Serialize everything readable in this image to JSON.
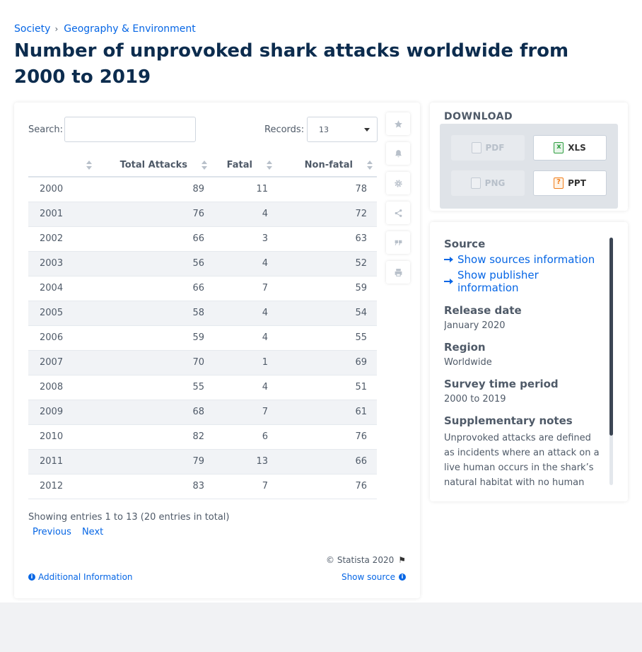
{
  "breadcrumb": {
    "items": [
      "Society",
      "Geography & Environment"
    ],
    "separator": "›"
  },
  "title": "Number of unprovoked shark attacks worldwide from 2000 to 2019",
  "table_controls": {
    "search_label": "Search:",
    "search_value": "",
    "records_label": "Records:",
    "records_value": "13"
  },
  "table": {
    "columns": [
      "",
      "Total Attacks",
      "Fatal",
      "Non-fatal"
    ],
    "rows": [
      [
        "2000",
        "89",
        "11",
        "78"
      ],
      [
        "2001",
        "76",
        "4",
        "72"
      ],
      [
        "2002",
        "66",
        "3",
        "63"
      ],
      [
        "2003",
        "56",
        "4",
        "52"
      ],
      [
        "2004",
        "66",
        "7",
        "59"
      ],
      [
        "2005",
        "58",
        "4",
        "54"
      ],
      [
        "2006",
        "59",
        "4",
        "55"
      ],
      [
        "2007",
        "70",
        "1",
        "69"
      ],
      [
        "2008",
        "55",
        "4",
        "51"
      ],
      [
        "2009",
        "68",
        "7",
        "61"
      ],
      [
        "2010",
        "82",
        "6",
        "76"
      ],
      [
        "2011",
        "79",
        "13",
        "66"
      ],
      [
        "2012",
        "83",
        "7",
        "76"
      ]
    ]
  },
  "entries_info": "Showing entries 1 to 13 (20 entries in total)",
  "pager": {
    "previous": "Previous",
    "next": "Next"
  },
  "copyright": "© Statista 2020",
  "links": {
    "additional_info": "Additional Information",
    "show_source": "Show source"
  },
  "side_tools": [
    "star-icon",
    "bell-icon",
    "gear-icon",
    "share-icon",
    "quote-icon",
    "print-icon"
  ],
  "download": {
    "title": "DOWNLOAD",
    "buttons": [
      {
        "label": "PDF",
        "enabled": false
      },
      {
        "label": "XLS",
        "enabled": true
      },
      {
        "label": "PNG",
        "enabled": false
      },
      {
        "label": "PPT",
        "enabled": true
      }
    ]
  },
  "source": {
    "heading": "Source",
    "show_sources": "Show sources information",
    "show_publisher": "Show publisher information",
    "release_date_label": "Release date",
    "release_date": "January 2020",
    "region_label": "Region",
    "region": "Worldwide",
    "survey_label": "Survey time period",
    "survey": "2000 to 2019",
    "notes_label": "Supplementary notes",
    "notes": "Unprovoked attacks are defined as incidents where an attack on a live human occurs in the shark’s natural habitat with no human"
  },
  "colors": {
    "accent": "#0666e5",
    "title": "#0c2c4e",
    "text": "#4f5a68"
  }
}
